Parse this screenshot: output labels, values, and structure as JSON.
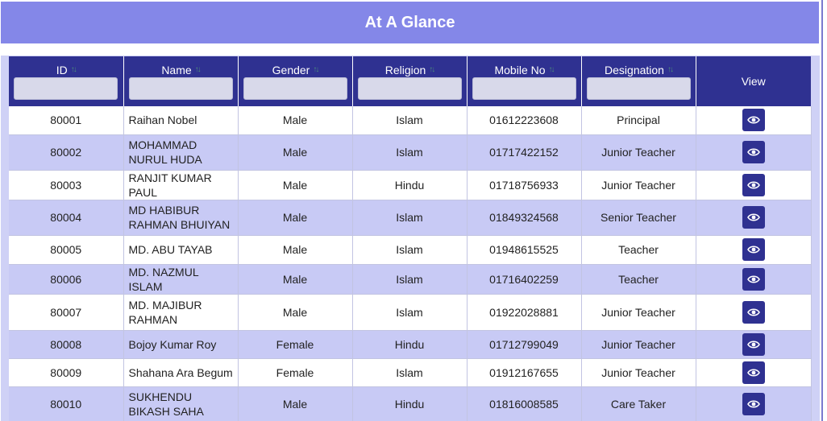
{
  "banner": {
    "title": "At A Glance"
  },
  "table": {
    "columns": [
      {
        "key": "id",
        "label": "ID",
        "sortable": true,
        "filter": ""
      },
      {
        "key": "name",
        "label": "Name",
        "sortable": true,
        "filter": ""
      },
      {
        "key": "gender",
        "label": "Gender",
        "sortable": true,
        "filter": ""
      },
      {
        "key": "religion",
        "label": "Religion",
        "sortable": true,
        "filter": ""
      },
      {
        "key": "mobile",
        "label": "Mobile No",
        "sortable": true,
        "filter": ""
      },
      {
        "key": "designation",
        "label": "Designation",
        "sortable": true,
        "filter": ""
      },
      {
        "key": "view",
        "label": "View",
        "sortable": false
      }
    ],
    "rows": [
      {
        "id": "80001",
        "name": "Raihan Nobel",
        "gender": "Male",
        "religion": "Islam",
        "mobile": "01612223608",
        "designation": "Principal"
      },
      {
        "id": "80002",
        "name": "MOHAMMAD NURUL HUDA",
        "gender": "Male",
        "religion": "Islam",
        "mobile": "01717422152",
        "designation": "Junior Teacher"
      },
      {
        "id": "80003",
        "name": "RANJIT KUMAR PAUL",
        "gender": "Male",
        "religion": "Hindu",
        "mobile": "01718756933",
        "designation": "Junior Teacher"
      },
      {
        "id": "80004",
        "name": "MD HABIBUR RAHMAN BHUIYAN",
        "gender": "Male",
        "religion": "Islam",
        "mobile": "01849324568",
        "designation": "Senior Teacher"
      },
      {
        "id": "80005",
        "name": "MD. ABU TAYAB",
        "gender": "Male",
        "religion": "Islam",
        "mobile": "01948615525",
        "designation": "Teacher"
      },
      {
        "id": "80006",
        "name": "MD. NAZMUL ISLAM",
        "gender": "Male",
        "religion": "Islam",
        "mobile": "01716402259",
        "designation": "Teacher"
      },
      {
        "id": "80007",
        "name": "MD. MAJIBUR RAHMAN",
        "gender": "Male",
        "religion": "Islam",
        "mobile": "01922028881",
        "designation": "Junior Teacher"
      },
      {
        "id": "80008",
        "name": "Bojoy Kumar Roy",
        "gender": "Female",
        "religion": "Hindu",
        "mobile": "01712799049",
        "designation": "Junior Teacher"
      },
      {
        "id": "80009",
        "name": "Shahana Ara Begum",
        "gender": "Female",
        "religion": "Islam",
        "mobile": "01912167655",
        "designation": "Junior Teacher"
      },
      {
        "id": "80010",
        "name": "SUKHENDU BIKASH SAHA",
        "gender": "Male",
        "religion": "Hindu",
        "mobile": "01816008585",
        "designation": "Care Taker"
      }
    ],
    "view_icon": "eye-icon"
  },
  "colors": {
    "banner": "#8487e8",
    "header": "#2f3191",
    "row_alt": "#c8caf5",
    "panel": "#cfd1f6"
  }
}
